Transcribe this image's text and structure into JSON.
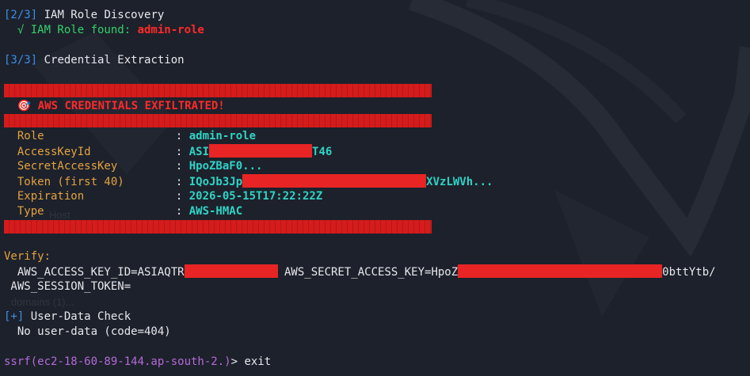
{
  "step2": {
    "tag": "[2/3]",
    "title": "IAM Role Discovery",
    "found_prefix": "  √ IAM Role found: ",
    "found_value": "admin-role"
  },
  "step3": {
    "tag": "[3/3]",
    "title": "Credential Extraction"
  },
  "banner": {
    "icon": "🎯",
    "text": "AWS CREDENTIALS EXFILTRATED!"
  },
  "creds": [
    {
      "label": "Role",
      "value_start": "admin-role",
      "value_end": ""
    },
    {
      "label": "AccessKeyId",
      "value_start": "ASI",
      "value_end": "T46"
    },
    {
      "label": "SecretAccessKey",
      "value_start": "HpoZBaF0...",
      "value_end": ""
    },
    {
      "label": "Token (first 40)",
      "value_start": "IQoJb3Jp",
      "value_end": "XVzLWVh..."
    },
    {
      "label": "Expiration",
      "value_start": "2026-05-15T17:22:22Z",
      "value_end": ""
    },
    {
      "label": "Type",
      "value_start": "AWS-HMAC",
      "value_end": ""
    }
  ],
  "verify": {
    "label": "Verify:",
    "line1_a": "  AWS_ACCESS_KEY_ID=ASIAQTR",
    "line1_b": " AWS_SECRET_ACCESS_KEY=HpoZ",
    "line1_c": "0bttYtb/",
    "line2": " AWS_SESSION_TOKEN="
  },
  "userdata": {
    "tag": "[+]",
    "title": "User-Data Check",
    "result": "  No user-data (code=404)"
  },
  "prompt": {
    "host": "ssrf(ec2-18-60-89-144.ap-south-2.)",
    "symbol": "> ",
    "command": "exit"
  },
  "background_faint": {
    "text_a": "domains (1)...",
    "text_b": "Host"
  },
  "colors": {
    "background": "#1d212b",
    "tag": "#3b8eea",
    "success": "#34d16b",
    "alert": "#ff2a2a",
    "label": "#e3a341",
    "value": "#2fd3c6",
    "prompt": "#b46ad9",
    "redaction": "#e82424"
  }
}
